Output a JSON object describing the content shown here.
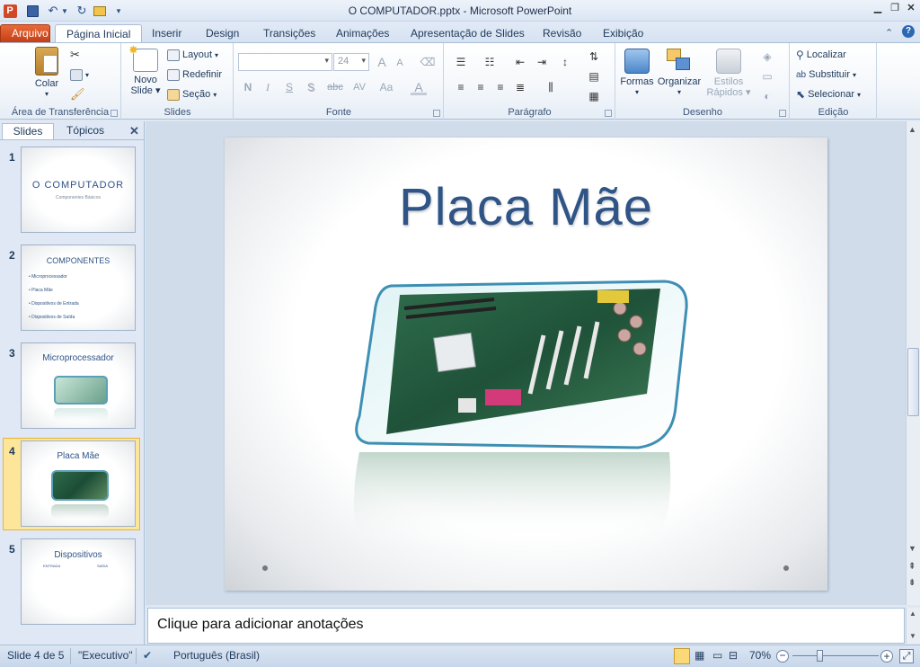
{
  "window": {
    "title": "O COMPUTADOR.pptx  -  Microsoft PowerPoint"
  },
  "tabs": [
    {
      "label": "Arquivo"
    },
    {
      "label": "Página Inicial"
    },
    {
      "label": "Inserir"
    },
    {
      "label": "Design"
    },
    {
      "label": "Transições"
    },
    {
      "label": "Animações"
    },
    {
      "label": "Apresentação de Slides"
    },
    {
      "label": "Revisão"
    },
    {
      "label": "Exibição"
    }
  ],
  "ribbon": {
    "clipboard": {
      "paste": "Colar",
      "group": "Área de Transferência"
    },
    "slides": {
      "new_slide_1": "Novo",
      "new_slide_2": "Slide",
      "layout": "Layout",
      "reset": "Redefinir",
      "section": "Seção",
      "group": "Slides"
    },
    "font": {
      "size": "24",
      "group": "Fonte",
      "bold": "N",
      "italic": "I",
      "underline": "S",
      "shadow": "S",
      "strike": "abc",
      "spacing": "AV",
      "case": "Aa",
      "color": "A",
      "grow": "A",
      "shrink": "A"
    },
    "paragraph": {
      "group": "Parágrafo"
    },
    "drawing": {
      "shapes": "Formas",
      "arrange": "Organizar",
      "quick_styles_1": "Estilos",
      "quick_styles_2": "Rápidos",
      "group": "Desenho"
    },
    "editing": {
      "find": "Localizar",
      "replace": "Substituir",
      "select": "Selecionar",
      "group": "Edição"
    }
  },
  "panel": {
    "tabs": [
      "Slides",
      "Tópicos"
    ],
    "slides": [
      {
        "num": "1",
        "title": "O COMPUTADOR",
        "subtitle": "Componentes Básicos"
      },
      {
        "num": "2",
        "title": "COMPONENTES",
        "bullets": [
          "Microprocessador",
          "Placa Mãe",
          "Dispositivos de Entrada",
          "Dispositivos de Saída"
        ]
      },
      {
        "num": "3",
        "title": "Microprocessador"
      },
      {
        "num": "4",
        "title": "Placa Mãe"
      },
      {
        "num": "5",
        "title": "Dispositivos",
        "col1": "ENTRADA",
        "col2": "SAÍDA"
      }
    ]
  },
  "slide": {
    "title": "Placa Mãe"
  },
  "notes": {
    "placeholder": "Clique para adicionar anotações"
  },
  "status": {
    "slide_info": "Slide 4 de 5",
    "theme": "\"Executivo\"",
    "language": "Português (Brasil)",
    "zoom": "70%"
  },
  "colors": {
    "accent_file_tab": "#d2512a",
    "slide_title": "#2f5486",
    "selected_thumb": "#fde69a"
  }
}
